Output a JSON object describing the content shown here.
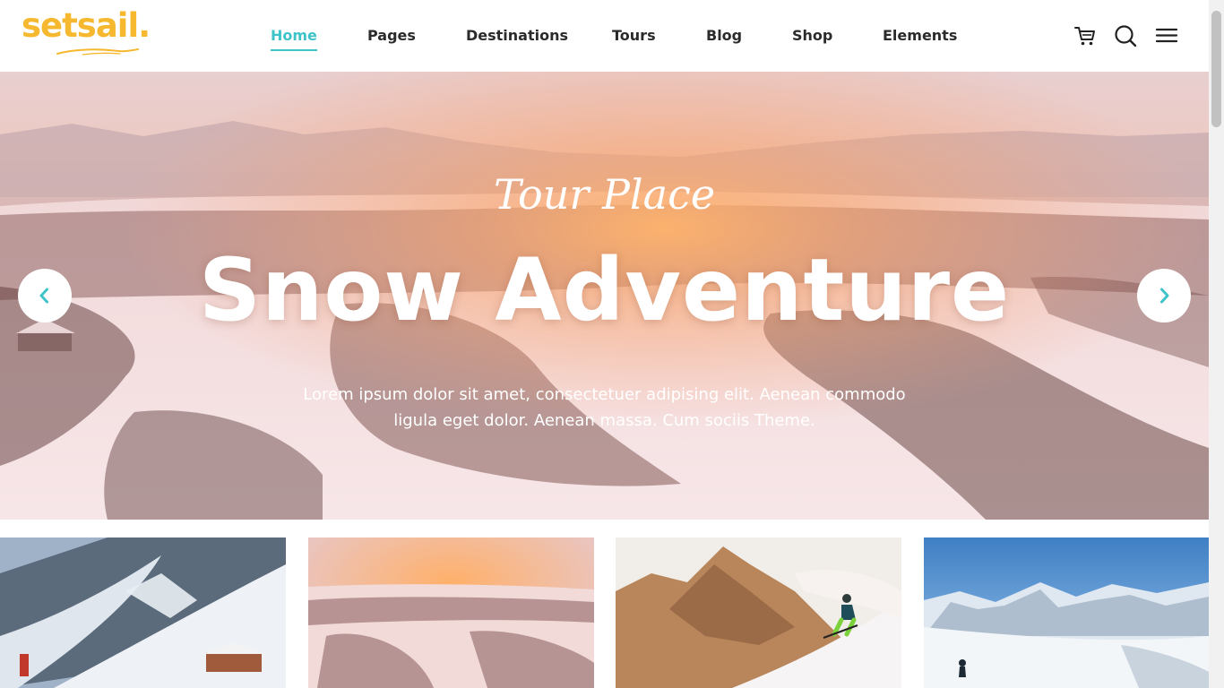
{
  "header": {
    "logo": "setsail.",
    "nav": [
      {
        "label": "Home",
        "active": true
      },
      {
        "label": "Pages",
        "active": false
      },
      {
        "label": "Destinations",
        "active": false
      },
      {
        "label": "Tours",
        "active": false
      },
      {
        "label": "Blog",
        "active": false
      },
      {
        "label": "Shop",
        "active": false
      },
      {
        "label": "Elements",
        "active": false
      }
    ],
    "icons": [
      "cart-icon",
      "search-icon",
      "menu-icon"
    ]
  },
  "hero": {
    "subtitle": "Tour Place",
    "title": "Snow Adventure",
    "text_line1": "Lorem ipsum dolor sit amet, consectetuer adipising elit. Aenean commodo",
    "text_line2": "ligula eget dolor. Aenean massa. Cum sociis Theme.",
    "prev_icon": "chevron-left-icon",
    "next_icon": "chevron-right-icon"
  },
  "cards": [
    {
      "image": "snowy-mountain-chalet"
    },
    {
      "image": "snowy-forest-sunset"
    },
    {
      "image": "skier-rocky-slope"
    },
    {
      "image": "alpine-ski-slope"
    }
  ],
  "colors": {
    "accent": "#3ec3c9",
    "logo": "#f5b82e",
    "nav_text": "#2b2b2b"
  }
}
